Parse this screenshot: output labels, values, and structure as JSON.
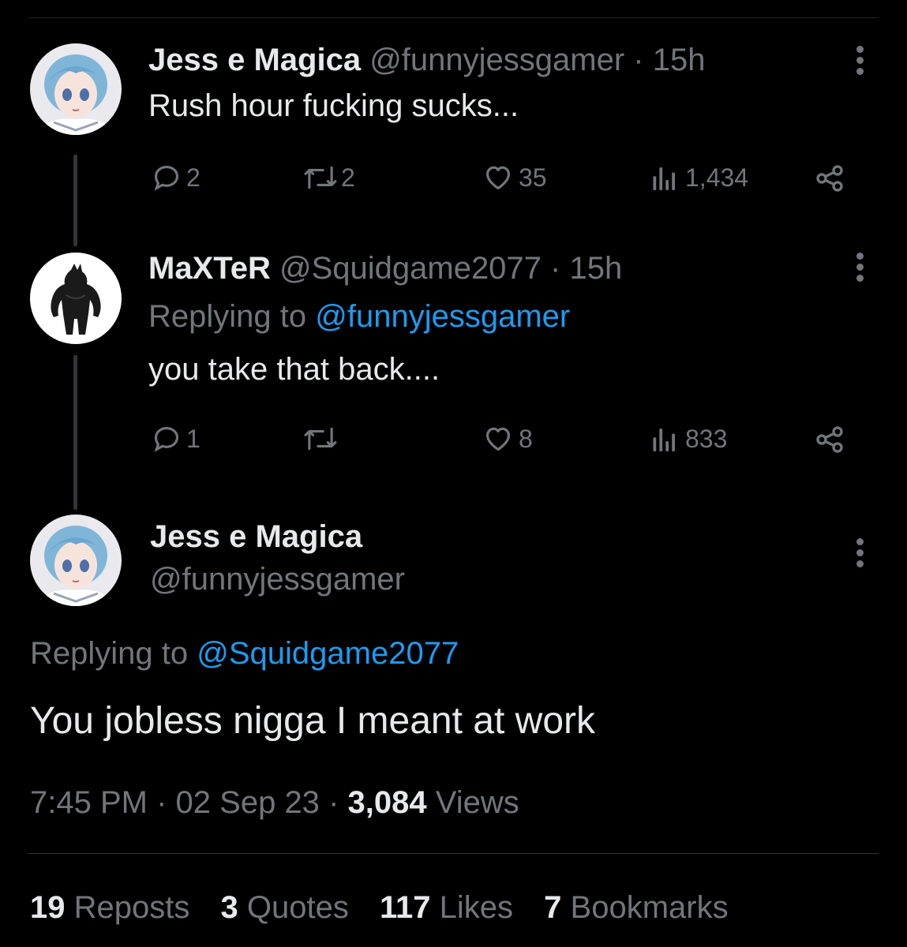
{
  "tweet1": {
    "display_name": "Jess e Magica",
    "handle": "@funnyjessgamer",
    "sep": "·",
    "time": "15h",
    "text": "Rush hour fucking sucks...",
    "replies": "2",
    "reposts": "2",
    "likes": "35",
    "views": "1,434"
  },
  "tweet2": {
    "display_name": "MaXTeR",
    "handle": "@Squidgame2077",
    "sep": "·",
    "time": "15h",
    "replying_prefix": "Replying to",
    "replying_handle": "@funnyjessgamer",
    "text": "you take that back....",
    "replies": "1",
    "reposts": "",
    "likes": "8",
    "views": "833"
  },
  "main_tweet": {
    "display_name": "Jess e Magica",
    "handle": "@funnyjessgamer",
    "replying_prefix": "Replying to",
    "replying_handle": "@Squidgame2077",
    "text": "You jobless nigga I meant at work",
    "time": "7:45 PM",
    "sep1": "·",
    "date": "02 Sep 23",
    "sep2": "·",
    "views_count": "3,084",
    "views_label": "Views"
  },
  "stats": {
    "reposts_count": "19",
    "reposts_label": "Reposts",
    "quotes_count": "3",
    "quotes_label": "Quotes",
    "likes_count": "117",
    "likes_label": "Likes",
    "bookmarks_count": "7",
    "bookmarks_label": "Bookmarks"
  },
  "icons": {
    "reply": "reply-icon",
    "repost": "repost-icon",
    "like": "heart-icon",
    "views": "analytics-icon",
    "share": "share-icon",
    "more": "more-dots-icon"
  },
  "colors": {
    "background": "#000000",
    "text": "#e7e9ea",
    "muted": "#71767b",
    "link": "#1d9bf0",
    "thread_line": "#333639"
  }
}
